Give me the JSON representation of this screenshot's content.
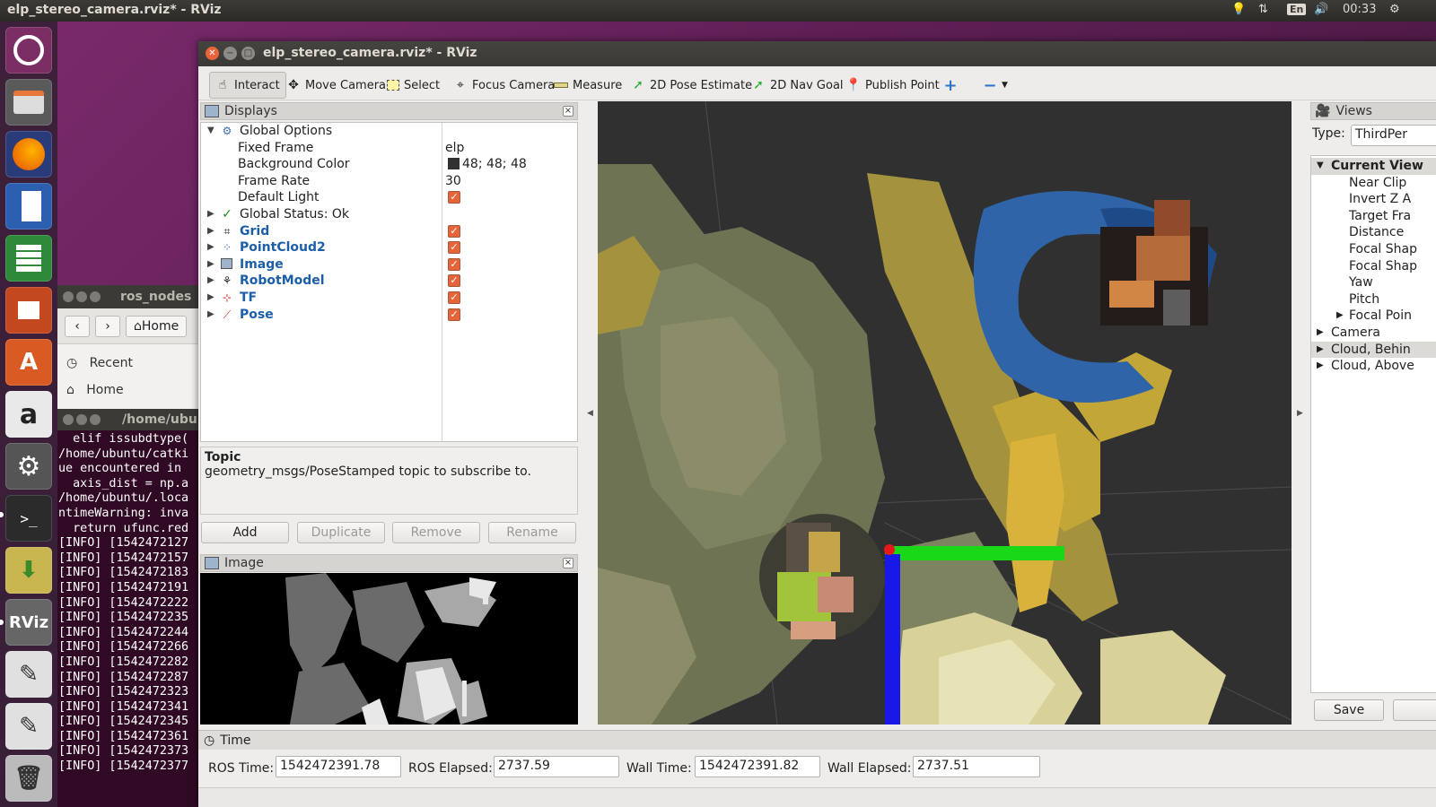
{
  "topbar": {
    "title": "elp_stereo_camera.rviz* - RViz",
    "keyboard": "En",
    "clock": "00:33"
  },
  "file_window": {
    "title": "ros_nodes",
    "home_button": "Home",
    "sidebar": [
      "Recent",
      "Home"
    ]
  },
  "terminal": {
    "title": "/home/ubun",
    "lines": [
      "  elif issubdtype(",
      "/home/ubuntu/catki",
      "ue encountered in",
      "  axis_dist = np.a",
      "/home/ubuntu/.loca",
      "ntimeWarning: inva",
      "  return ufunc.red",
      "[INFO] [1542472127",
      "[INFO] [1542472157",
      "[INFO] [1542472183",
      "[INFO] [1542472191",
      "[INFO] [1542472222",
      "[INFO] [1542472235",
      "[INFO] [1542472244",
      "[INFO] [1542472266",
      "[INFO] [1542472282",
      "[INFO] [1542472287",
      "[INFO] [1542472323",
      "[INFO] [1542472341",
      "[INFO] [1542472345",
      "[INFO] [1542472361",
      "[INFO] [1542472373",
      "[INFO] [1542472377"
    ]
  },
  "rviz": {
    "title": "elp_stereo_camera.rviz* - RViz",
    "toolbar": {
      "interact": "Interact",
      "move_camera": "Move Camera",
      "select": "Select",
      "focus_camera": "Focus Camera",
      "measure": "Measure",
      "pose_estimate": "2D Pose Estimate",
      "nav_goal": "2D Nav Goal",
      "publish_point": "Publish Point"
    },
    "displays": {
      "header": "Displays",
      "global_options": "Global Options",
      "fixed_frame_label": "Fixed Frame",
      "fixed_frame_value": "elp",
      "bg_color_label": "Background Color",
      "bg_color_value": "48; 48; 48",
      "frame_rate_label": "Frame Rate",
      "frame_rate_value": "30",
      "default_light_label": "Default Light",
      "global_status": "Global Status: Ok",
      "items": [
        "Grid",
        "PointCloud2",
        "Image",
        "RobotModel",
        "TF",
        "Pose"
      ]
    },
    "topic": {
      "title": "Topic",
      "description": "geometry_msgs/PoseStamped topic to subscribe to."
    },
    "buttons": {
      "add": "Add",
      "duplicate": "Duplicate",
      "remove": "Remove",
      "rename": "Rename"
    },
    "image_panel": {
      "header": "Image"
    },
    "views": {
      "header": "Views",
      "type_label": "Type:",
      "type_value": "ThirdPer",
      "current_view": "Current View",
      "props": [
        "Near Clip",
        "Invert Z A",
        "Target Fra",
        "Distance",
        "Focal Shap",
        "Focal Shap",
        "Yaw",
        "Pitch",
        "Focal Poin"
      ],
      "saved": [
        "Camera",
        "Cloud, Behin",
        "Cloud, Above"
      ],
      "save_button": "Save"
    },
    "time": {
      "header": "Time",
      "ros_time_label": "ROS Time:",
      "ros_time": "1542472391.78",
      "ros_elapsed_label": "ROS Elapsed:",
      "ros_elapsed": "2737.59",
      "wall_time_label": "Wall Time:",
      "wall_time": "1542472391.82",
      "wall_elapsed_label": "Wall Elapsed:",
      "wall_elapsed": "2737.51"
    }
  },
  "colors": {
    "background_color_swatch": "#303030",
    "display_name_blue": "#1c5ea8",
    "checkbox_orange": "#e6643a"
  }
}
